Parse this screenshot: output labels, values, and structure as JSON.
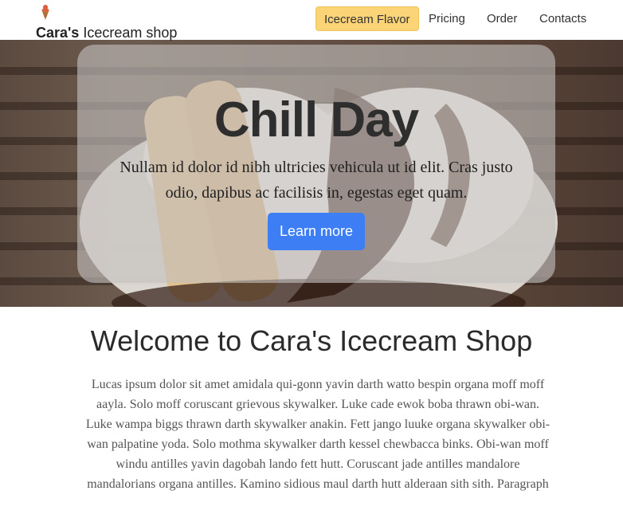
{
  "navbar": {
    "brand_bold": "Cara's",
    "brand_rest": " Icecream shop",
    "logo_icon": "icecream-cone-icon",
    "links": [
      {
        "label": "Icecream Flavor",
        "active": true
      },
      {
        "label": "Pricing",
        "active": false
      },
      {
        "label": "Order",
        "active": false
      },
      {
        "label": "Contacts",
        "active": false
      }
    ]
  },
  "hero": {
    "title": "Chill Day",
    "text": "Nullam id dolor id nibh ultricies vehicula ut id elit. Cras justo odio, dapibus ac facilisis in, egestas eget quam.",
    "button_label": "Learn more"
  },
  "welcome": {
    "title": "Welcome to Cara's Icecream Shop",
    "text": "Lucas ipsum dolor sit amet amidala qui-gonn yavin darth watto bespin organa moff moff aayla. Solo moff coruscant grievous skywalker. Luke cade ewok boba thrawn obi-wan. Luke wampa biggs thrawn darth skywalker anakin. Fett jango luuke organa skywalker obi-wan palpatine yoda. Solo mothma skywalker darth kessel chewbacca binks. Obi-wan moff windu antilles yavin dagobah lando fett hutt. Coruscant jade antilles mandalore mandalorians organa antilles. Kamino sidious maul darth hutt alderaan sith sith. Paragraph"
  },
  "colors": {
    "active_nav": "#fbd478",
    "button": "#3d7ef5"
  }
}
